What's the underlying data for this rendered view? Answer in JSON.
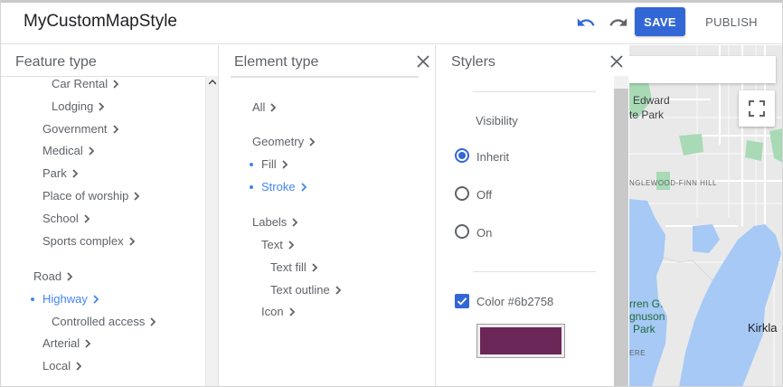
{
  "header": {
    "title": "MyCustomMapStyle",
    "save_label": "SAVE",
    "publish_label": "PUBLISH"
  },
  "feature_panel": {
    "title": "Feature type",
    "items": [
      {
        "label": "Car Rental",
        "level": 3,
        "selected": false
      },
      {
        "label": "Lodging",
        "level": 3,
        "selected": false
      },
      {
        "label": "Government",
        "level": 2,
        "selected": false
      },
      {
        "label": "Medical",
        "level": 2,
        "selected": false
      },
      {
        "label": "Park",
        "level": 2,
        "selected": false
      },
      {
        "label": "Place of worship",
        "level": 2,
        "selected": false
      },
      {
        "label": "School",
        "level": 2,
        "selected": false
      },
      {
        "label": "Sports complex",
        "level": 2,
        "selected": false
      },
      {
        "label": "Road",
        "level": 1,
        "selected": false
      },
      {
        "label": "Highway",
        "level": 2,
        "selected": true
      },
      {
        "label": "Controlled access",
        "level": 3,
        "selected": false
      },
      {
        "label": "Arterial",
        "level": 2,
        "selected": false
      },
      {
        "label": "Local",
        "level": 2,
        "selected": false
      }
    ]
  },
  "element_panel": {
    "title": "Element type",
    "items": [
      {
        "label": "All",
        "level": 1,
        "selected": false
      },
      {
        "label": "Geometry",
        "level": 1,
        "selected": false
      },
      {
        "label": "Fill",
        "level": 2,
        "selected": false,
        "dot": true
      },
      {
        "label": "Stroke",
        "level": 2,
        "selected": true,
        "dot": true
      },
      {
        "label": "Labels",
        "level": 1,
        "selected": false
      },
      {
        "label": "Text",
        "level": 2,
        "selected": false
      },
      {
        "label": "Text fill",
        "level": 3,
        "selected": false
      },
      {
        "label": "Text outline",
        "level": 3,
        "selected": false
      },
      {
        "label": "Icon",
        "level": 2,
        "selected": false
      }
    ]
  },
  "stylers_panel": {
    "title": "Stylers",
    "visibility_label": "Visibility",
    "options": [
      {
        "label": "Inherit",
        "checked": true
      },
      {
        "label": "Off",
        "checked": false
      },
      {
        "label": "On",
        "checked": false
      }
    ],
    "color_label": "Color #6b2758",
    "color_checked": true,
    "color_value": "#6b2758"
  },
  "map": {
    "labels": {
      "edward": "Edward",
      "park1": "te Park",
      "inglewood": "NGLEWOOD-FINN HILL",
      "warren": "rren G.",
      "magnuson": "gnuson",
      "park2": "Park",
      "kirkland": "Kirkla",
      "ere": "ERE"
    },
    "water_color": "#a6c9f5",
    "park_color": "#a8dab5"
  },
  "colors": {
    "accent": "#3367d6",
    "selected_text": "#4285f4"
  }
}
